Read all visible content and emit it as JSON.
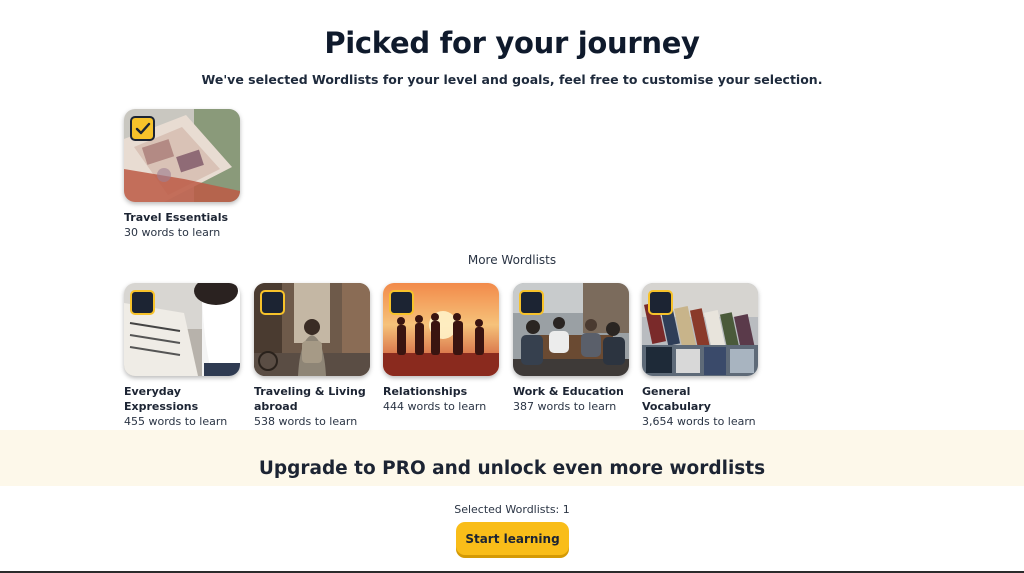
{
  "header": {
    "title": "Picked for your journey",
    "subtitle": "We've selected Wordlists for your level and goals, feel free to customise your selection."
  },
  "selected_lists": [
    {
      "name": "Travel Essentials",
      "count": "30 words to learn",
      "checked": true
    }
  ],
  "more_section": {
    "label": "More Wordlists",
    "lists": [
      {
        "name": "Everyday Expressions",
        "count": "455 words to learn",
        "checked": false
      },
      {
        "name": "Traveling & Living abroad",
        "count": "538 words to learn",
        "checked": false
      },
      {
        "name": "Relationships",
        "count": "444 words to learn",
        "checked": false
      },
      {
        "name": "Work & Education",
        "count": "387 words to learn",
        "checked": false
      },
      {
        "name": "General Vocabulary",
        "count": "3,654 words to learn",
        "checked": false
      }
    ]
  },
  "upgrade": {
    "text": "Upgrade to PRO and unlock even more wordlists"
  },
  "footer": {
    "selected_info": "Selected Wordlists: 1",
    "start_label": "Start learning"
  },
  "colors": {
    "accent": "#f9bd19",
    "checkbox_border": "#f7c22a",
    "checkbox_fill": "#1c2433",
    "upgrade_band": "#fdf8ea",
    "text": "#1c2433"
  }
}
